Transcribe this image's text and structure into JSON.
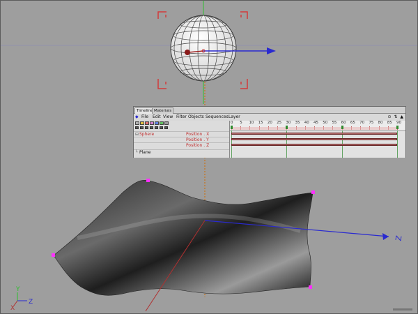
{
  "timeline": {
    "tabs": [
      "Timeline",
      "Materials"
    ],
    "menu": [
      "File",
      "Edit",
      "View",
      "Filter",
      "Objects",
      "Sequences",
      "Layer"
    ],
    "corner_icons": "⊙ ⇅ ▲",
    "objects": {
      "sphere": "Sphere",
      "plane": "Plane"
    },
    "tracks": [
      "Position . X",
      "Position . Y",
      "Position . Z"
    ],
    "ruler": [
      "0",
      "5",
      "10",
      "15",
      "20",
      "25",
      "30",
      "35",
      "40",
      "45",
      "50",
      "55",
      "60",
      "65",
      "70",
      "75",
      "80",
      "85",
      "90"
    ],
    "keyframes_at": [
      0,
      30,
      60,
      90
    ],
    "colors": {
      "track_bar": "#b36b6b",
      "keyframe_marker": "#2d8a2d",
      "sphere_label": "#c03030"
    }
  },
  "viewport": {
    "axis_labels": {
      "y": "Y",
      "z": "Z",
      "x": "X",
      "z_handle": "Z"
    },
    "colors": {
      "background": "#9e9e9e",
      "selection_bracket": "#d23a3a",
      "y_axis": "#2fbf2f",
      "z_axis": "#2a2ad0",
      "x_axis": "#b03030",
      "plane_point": "#ff30ff"
    }
  }
}
